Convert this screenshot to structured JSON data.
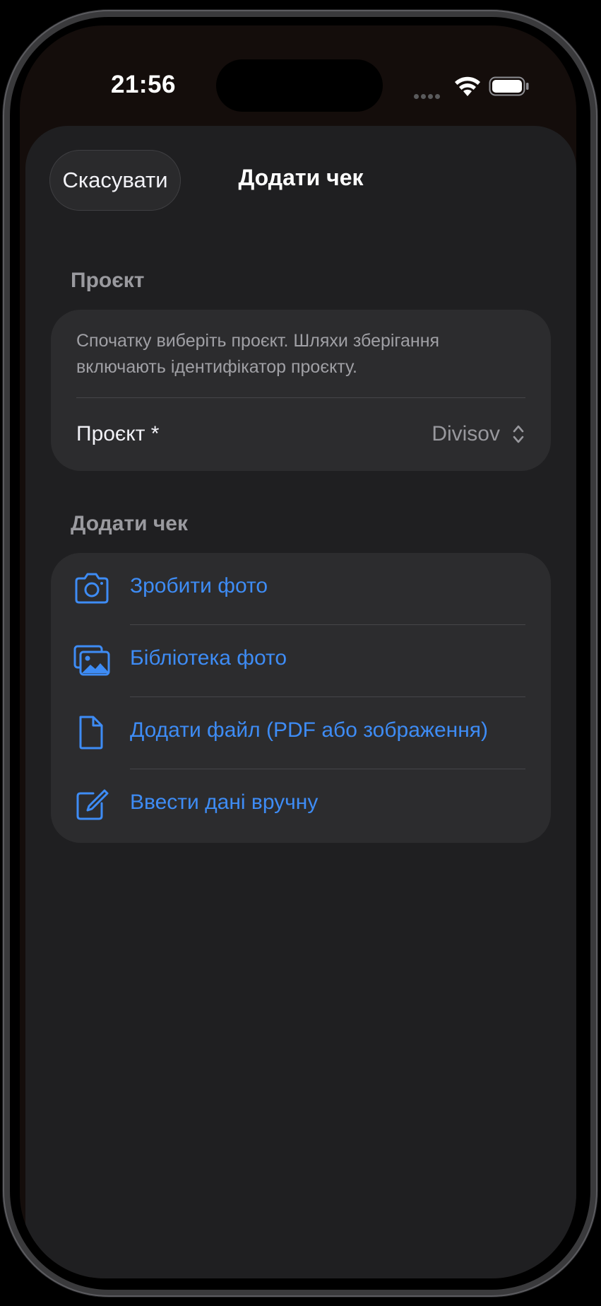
{
  "status_bar": {
    "time": "21:56"
  },
  "nav": {
    "cancel_label": "Скасувати",
    "title": "Додати чек"
  },
  "project_section": {
    "header": "Проєкт",
    "description": "Спочатку виберіть проєкт. Шляхи зберігання включають ідентифікатор проєкту.",
    "field_label": "Проєкт *",
    "field_value": "Divisov"
  },
  "receipt_section": {
    "header": "Додати чек",
    "actions": [
      {
        "label": "Зробити фото",
        "icon": "camera-icon"
      },
      {
        "label": "Бібліотека фото",
        "icon": "photo-library-icon"
      },
      {
        "label": "Додати файл (PDF або зображення)",
        "icon": "document-icon"
      },
      {
        "label": "Ввести дані вручну",
        "icon": "compose-icon"
      }
    ]
  },
  "colors": {
    "accent": "#3e8cf5",
    "sheet": "#1f1f21",
    "card": "#2c2c2e"
  }
}
